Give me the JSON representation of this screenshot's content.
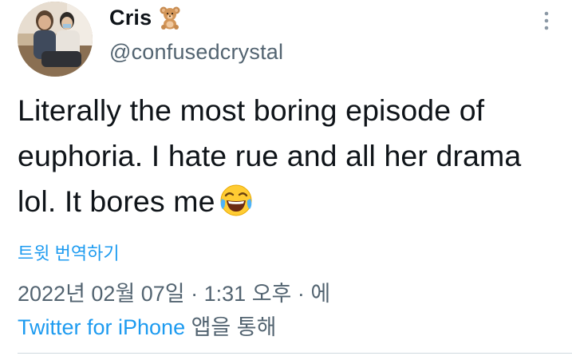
{
  "user": {
    "display_name": "Cris",
    "name_emoji": "teddy-bear-icon",
    "handle": "@confusedcrystal"
  },
  "tweet": {
    "text": "Literally the most boring episode of euphoria. I hate rue and all her drama lol. It bores me",
    "trailing_emoji": "face-with-tears-of-joy-icon"
  },
  "translate_label": "트윗 번역하기",
  "meta": {
    "date_time": "2022년 02월 07일 · 1:31 오후 · 에",
    "source_app": "Twitter for iPhone",
    "source_suffix": " 앱을 통해"
  },
  "colors": {
    "link": "#1d9bf0",
    "secondary_text": "#536471",
    "primary_text": "#0f1419",
    "divider": "#cfd9de"
  }
}
